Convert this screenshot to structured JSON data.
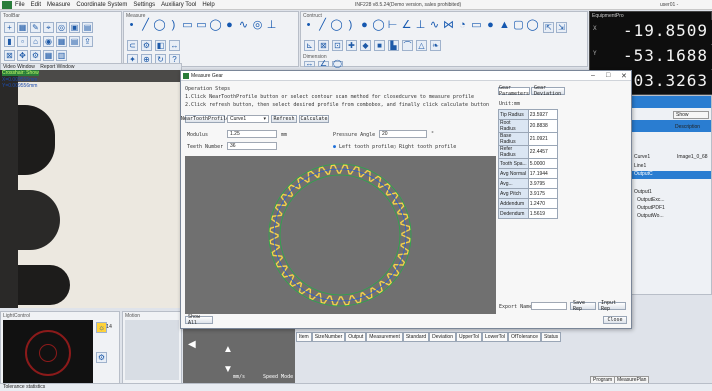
{
  "menu": {
    "items": [
      "File",
      "Edit",
      "Measure",
      "Coordinate System",
      "Settings",
      "Auxiliary Tool",
      "Help"
    ],
    "app_title": "INF228 v8.5.24(Demo version, sales prohibited)",
    "user_label": "user01 -"
  },
  "panels": {
    "toolbar_title": "ToolBar",
    "measure_title": "Measure",
    "construct_title": "Contruct",
    "dimension_title": "Dimension",
    "equipment_title": "EquipmentPro"
  },
  "readouts": [
    {
      "axis": "X",
      "value": "-19.8509"
    },
    {
      "axis": "Y",
      "value": "-53.1688"
    },
    {
      "axis": "Z",
      "value": "-103.3263"
    }
  ],
  "video": {
    "tabs": [
      "Video Window",
      "Report Window"
    ],
    "coords": [
      "Crosshair: Show",
      "X=0.009555mm",
      "Y=0.009556mm"
    ]
  },
  "light_control": {
    "title": "LightControl",
    "motion_title": "Motion",
    "speed_label": "Speed Mode",
    "units": "mm/s",
    "value": "14"
  },
  "dialog": {
    "title": "Measure Gear",
    "steps_title": "Operation Steps",
    "steps": [
      "1.Click NearToothProfile button or select contour scan method for closedcurve to measure profile",
      "2.Click refresh button, then select desired profile from combobox, and finally click calculate button"
    ],
    "tooth_profile_btn": "NearToothProfile",
    "curve_select": "Curve1",
    "refresh_btn": "Refresh",
    "calculate_btn": "Calculate",
    "module_label": "Modulus",
    "module_value": "1.25",
    "module_unit": "mm",
    "teeth_label": "Teeth Number",
    "teeth_value": "36",
    "pressure_label": "Pressure Angle",
    "pressure_value": "20",
    "pressure_unit": "°",
    "left_radio": "Left tooth profile",
    "right_radio": "Right tooth profile",
    "gear_params_tab": "Gear Parameters",
    "gear_deviation_tab": "Gear Deviation",
    "unit_label": "Unit:mm",
    "results": [
      {
        "name": "Tip Radius",
        "value": "23.5927"
      },
      {
        "name": "Root Radius",
        "value": "20.8838"
      },
      {
        "name": "Base Radius",
        "value": "21.0921"
      },
      {
        "name": "Refer Radius",
        "value": "22.4457"
      },
      {
        "name": "Tooth Spa...",
        "value": "5.0000"
      },
      {
        "name": "Avg Normal",
        "value": "17.1944"
      },
      {
        "name": "Avg...",
        "value": "3.9795"
      },
      {
        "name": "Avg Pitch",
        "value": "3.9175"
      },
      {
        "name": "Addendum",
        "value": "1.2470"
      },
      {
        "name": "Dedendum",
        "value": "1.5619"
      }
    ],
    "export_label": "Export Name",
    "save_report_btn": "Save Rep",
    "input_report_btn": "Input Rep",
    "show_all_btn": "Show All",
    "close_btn": "Close"
  },
  "right_pane": {
    "description_header": "Description",
    "items": [
      "Curve1",
      "Image1_0_68",
      "Line1",
      "OutputC",
      "Output1",
      "OutputExc...",
      "OutputPDF1",
      "OutputWo..."
    ],
    "filter": "Show"
  },
  "bottom_table": {
    "columns": [
      "Item",
      "SizeNumber",
      "Output",
      "Measurement",
      "Standard",
      "Deviation",
      "UpperTol",
      "LowerTol",
      "OfTolerance",
      "Status"
    ]
  },
  "bottom_tabs": [
    "Program",
    "MeasurePlan"
  ],
  "status": {
    "text": "Tolerance statistics"
  }
}
